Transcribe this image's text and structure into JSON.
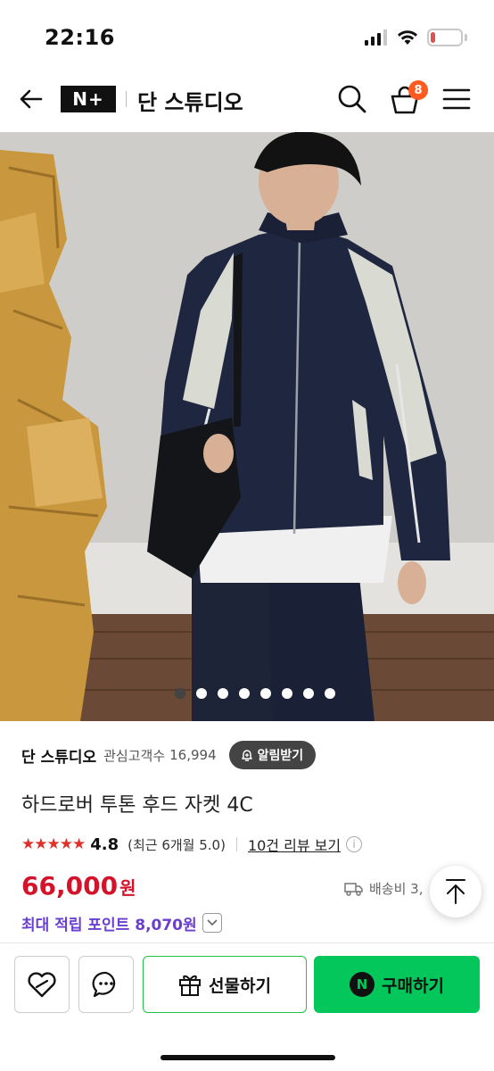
{
  "status_bar": {
    "time": "22:16",
    "battery": "17",
    "battery_level": 0.17,
    "icons": [
      "signal-icon",
      "wifi-icon",
      "battery-icon"
    ]
  },
  "header": {
    "logo": "N+",
    "store_name": "단 스튜디오",
    "cart_count": "8",
    "icons": [
      "back-arrow-icon",
      "search-icon",
      "cart-icon",
      "menu-icon"
    ]
  },
  "gallery": {
    "dot_count": 8,
    "active_index": 0
  },
  "store": {
    "name": "단 스튜디오",
    "interest_label": "관심고객수",
    "interest_count": "16,994",
    "notify_label": "알림받기"
  },
  "product": {
    "title": "하드로버 투톤 후드 자켓 4C",
    "stars": "★★★★★",
    "rating": "4.8",
    "rating_recent": "(최근 6개월 5.0)",
    "review_link": "10건 리뷰 보기",
    "price": "66,000",
    "price_unit": "원",
    "shipping": "배송비 3,",
    "points": "최대 적립 포인트 8,070원"
  },
  "bottom_bar": {
    "gift_label": "선물하기",
    "buy_label": "구매하기",
    "buy_logo": "N"
  },
  "colors": {
    "price": "#d4122a",
    "points": "#6a3fcf",
    "buy_button": "#03c75a",
    "gift_border": "#23c244",
    "cart_badge": "#ff5a1f",
    "stars": "#e0302a"
  }
}
